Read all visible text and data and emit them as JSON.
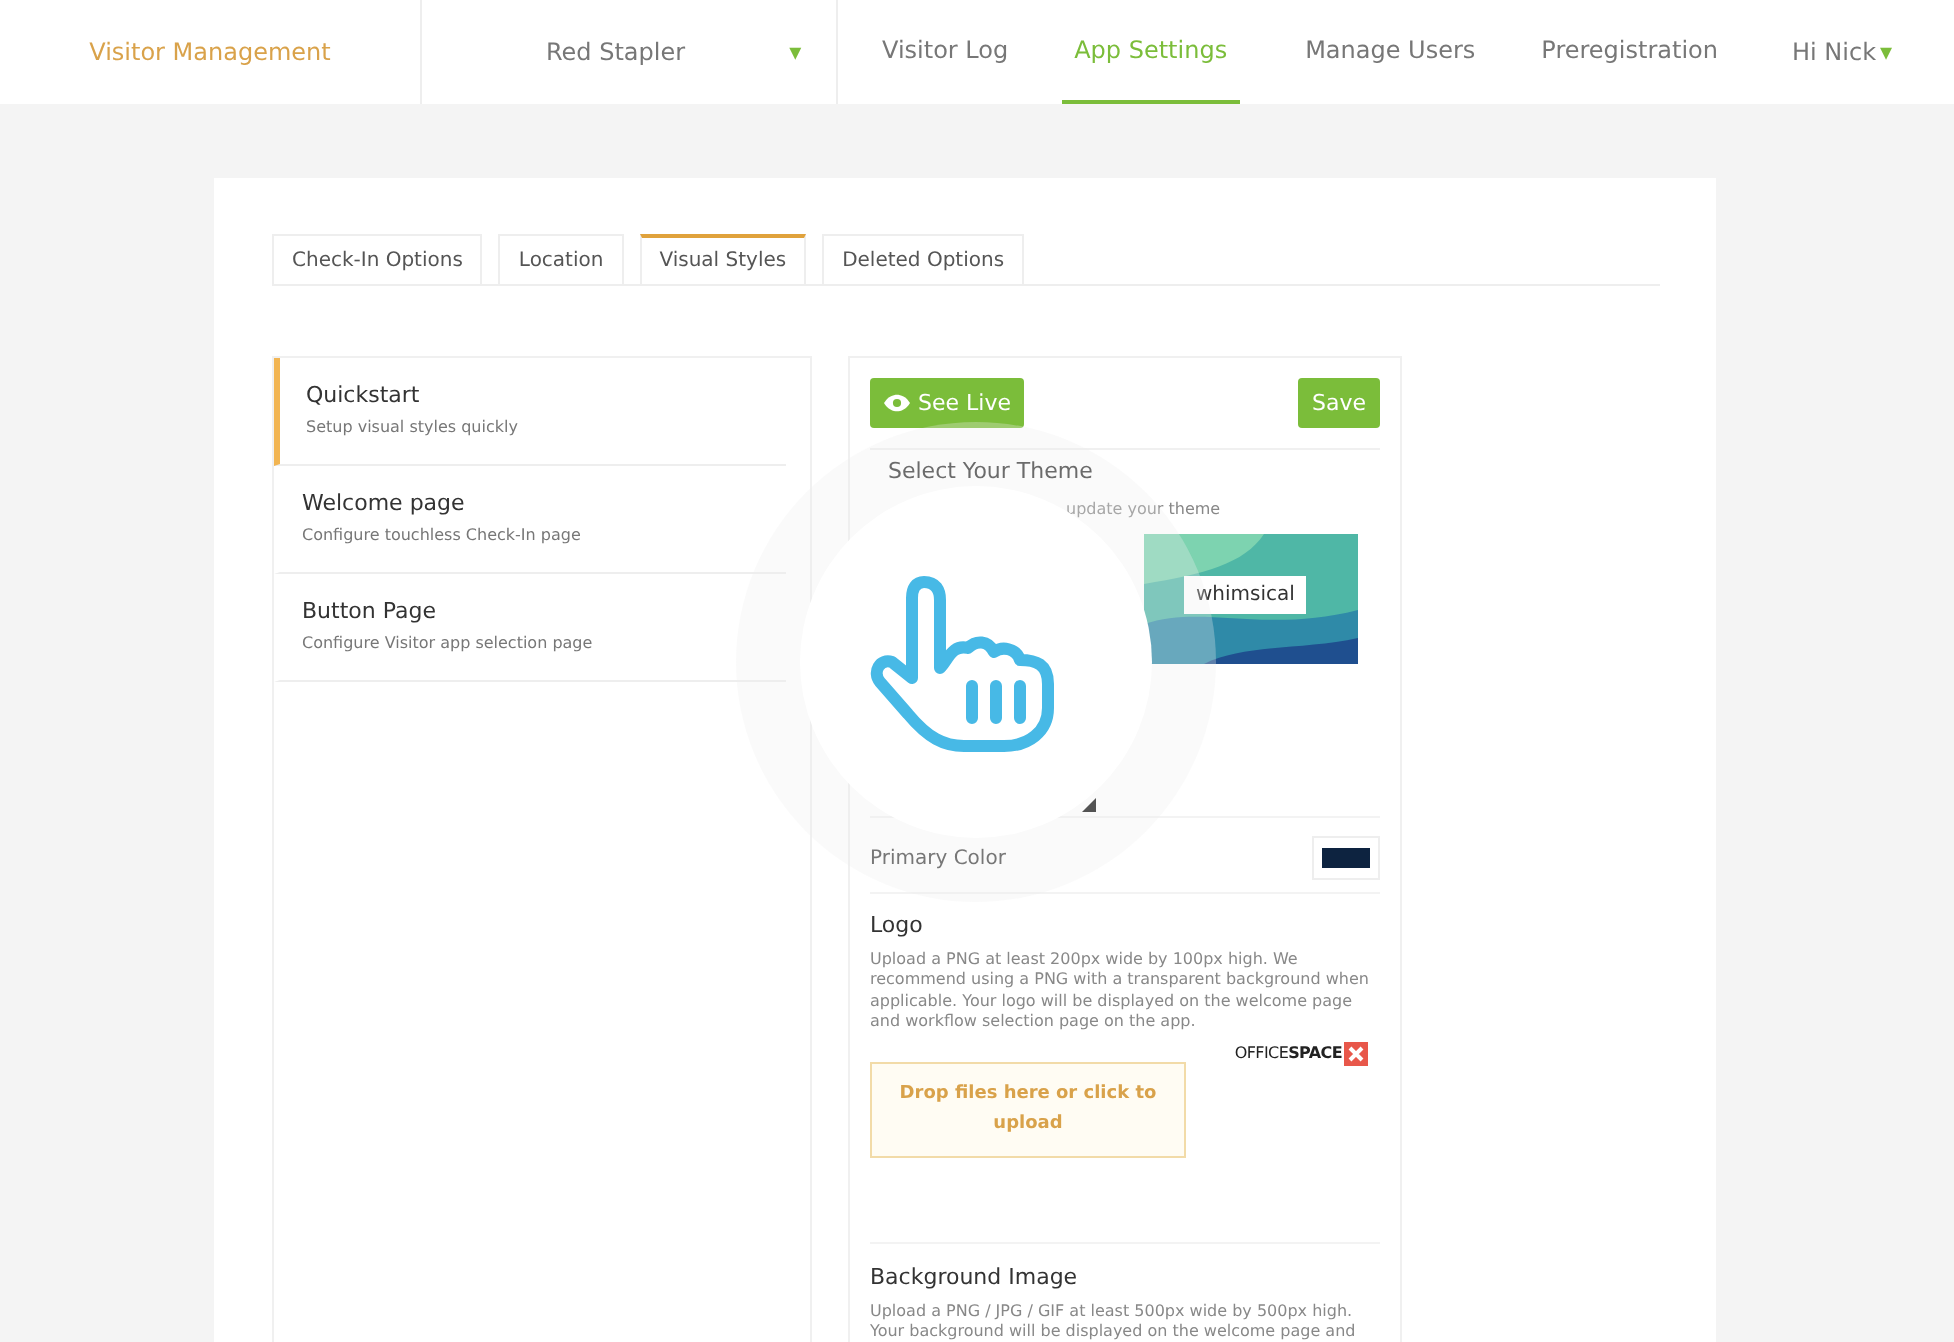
{
  "brand": "Visitor Management",
  "location": {
    "label": "Red Stapler",
    "caret": "▾"
  },
  "nav": [
    {
      "label": "Visitor Log",
      "selected": false
    },
    {
      "label": "App Settings",
      "selected": true
    },
    {
      "label": "Manage Users",
      "selected": false
    },
    {
      "label": "Preregistration",
      "selected": false
    }
  ],
  "user": {
    "label": "Hi Nick",
    "caret": "▾"
  },
  "tabs": [
    {
      "label": "Check-In Options",
      "selected": false
    },
    {
      "label": "Location",
      "selected": false
    },
    {
      "label": "Visual Styles",
      "selected": true
    },
    {
      "label": "Deleted Options",
      "selected": false
    }
  ],
  "sections": [
    {
      "title": "Quickstart",
      "subtitle": "Setup visual styles quickly",
      "selected": true
    },
    {
      "title": "Welcome page",
      "subtitle": "Configure touchless Check-In page",
      "selected": false
    },
    {
      "title": "Button Page",
      "subtitle": "Configure Visitor app selection page",
      "selected": false
    }
  ],
  "actions": {
    "see_live": "See Live",
    "save": "Save"
  },
  "theme": {
    "title": "Select Your Theme",
    "subtitle": "update your theme",
    "name": "whimsical"
  },
  "primary_color": {
    "label": "Primary Color",
    "color": "#0d2340"
  },
  "logo": {
    "title": "Logo",
    "help": "Upload a PNG at least 200px wide by 100px high. We recommend using a PNG with a transparent background when applicable. Your logo will be displayed on the welcome page and workflow selection page on the app.",
    "dropzone": "Drop files here or click to upload",
    "preview": "OFFICE**SPACE**"
  },
  "background": {
    "title": "Background Image",
    "help": "Upload a PNG / JPG / GIF at least 500px wide by 500px high. Your background will be displayed on the welcome page and"
  }
}
